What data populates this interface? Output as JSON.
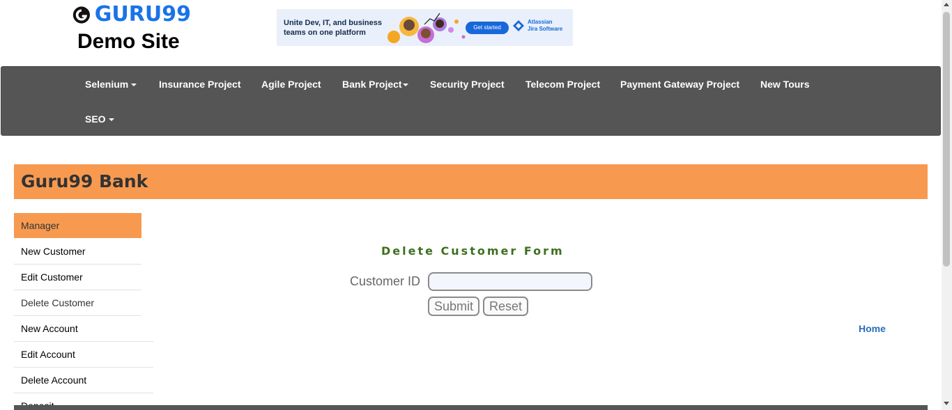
{
  "header": {
    "logo_text": "GURU99",
    "logo_subtitle": "Demo Site"
  },
  "ad": {
    "headline": "Unite Dev, IT, and business teams on one platform",
    "cta": "Get started",
    "brand_line1": "Atlassian",
    "brand_line2": "Jira Software"
  },
  "nav": {
    "items": [
      {
        "label": "Selenium",
        "dropdown": true
      },
      {
        "label": "Insurance Project",
        "dropdown": false
      },
      {
        "label": "Agile Project",
        "dropdown": false
      },
      {
        "label": "Bank Project",
        "dropdown": true
      },
      {
        "label": "Security Project",
        "dropdown": false
      },
      {
        "label": "Telecom Project",
        "dropdown": false
      },
      {
        "label": "Payment Gateway Project",
        "dropdown": false
      },
      {
        "label": "New Tours",
        "dropdown": false
      },
      {
        "label": "SEO",
        "dropdown": true
      }
    ]
  },
  "bank": {
    "title": "Guru99 Bank"
  },
  "sidebar": {
    "items": [
      {
        "label": "Manager"
      },
      {
        "label": "New Customer"
      },
      {
        "label": "Edit Customer"
      },
      {
        "label": "Delete Customer"
      },
      {
        "label": "New Account"
      },
      {
        "label": "Edit Account"
      },
      {
        "label": "Delete Account"
      },
      {
        "label": "Deposit"
      }
    ]
  },
  "form": {
    "title": "Delete Customer Form",
    "customer_id_label": "Customer ID",
    "customer_id_value": "",
    "submit_label": "Submit",
    "reset_label": "Reset"
  },
  "links": {
    "home": "Home"
  },
  "colors": {
    "accent_orange": "#f79a50",
    "navbar_bg": "#555555",
    "form_title": "#3e6f1f",
    "logo_blue": "#1a73e8",
    "link_blue": "#2a6ebb"
  }
}
